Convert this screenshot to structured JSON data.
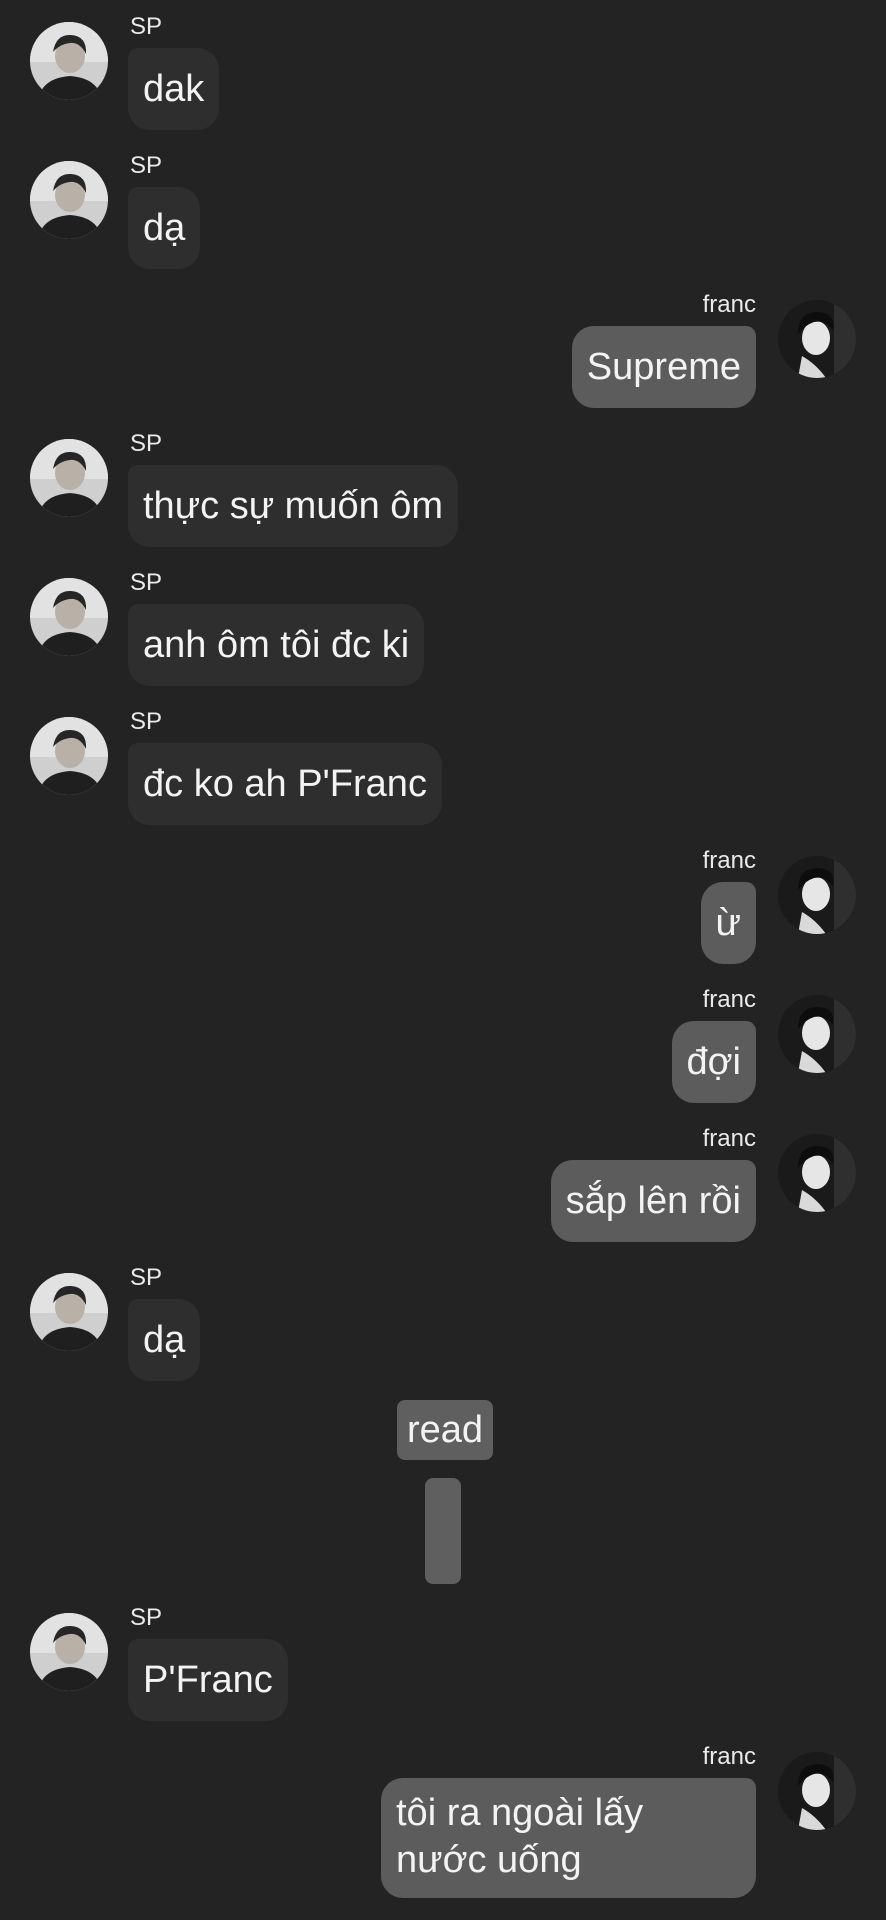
{
  "participants": {
    "left": {
      "name": "SP"
    },
    "right": {
      "name": "franc"
    }
  },
  "messages": [
    {
      "side": "left",
      "sender": "SP",
      "text": "dak"
    },
    {
      "side": "left",
      "sender": "SP",
      "text": "dạ"
    },
    {
      "side": "right",
      "sender": "franc",
      "text": "Supreme"
    },
    {
      "side": "left",
      "sender": "SP",
      "text": "thực sự muốn ôm"
    },
    {
      "side": "left",
      "sender": "SP",
      "text": "anh ôm tôi đc ki"
    },
    {
      "side": "left",
      "sender": "SP",
      "text": "đc ko ah P'Franc"
    },
    {
      "side": "right",
      "sender": "franc",
      "text": "ừ"
    },
    {
      "side": "right",
      "sender": "franc",
      "text": "đợi"
    },
    {
      "side": "right",
      "sender": "franc",
      "text": "sắp lên rồi"
    },
    {
      "side": "left",
      "sender": "SP",
      "text": "dạ"
    },
    {
      "side": "left",
      "sender": "SP",
      "text": "P'Franc"
    },
    {
      "side": "right",
      "sender": "franc",
      "text": "tôi ra ngoài lấy nước uống"
    }
  ],
  "read_marker": {
    "label": "read"
  },
  "colors": {
    "background": "#232323",
    "incoming_bubble": "#2e2e2e",
    "outgoing_bubble": "#5c5c5c",
    "text": "#f3f3f3"
  }
}
